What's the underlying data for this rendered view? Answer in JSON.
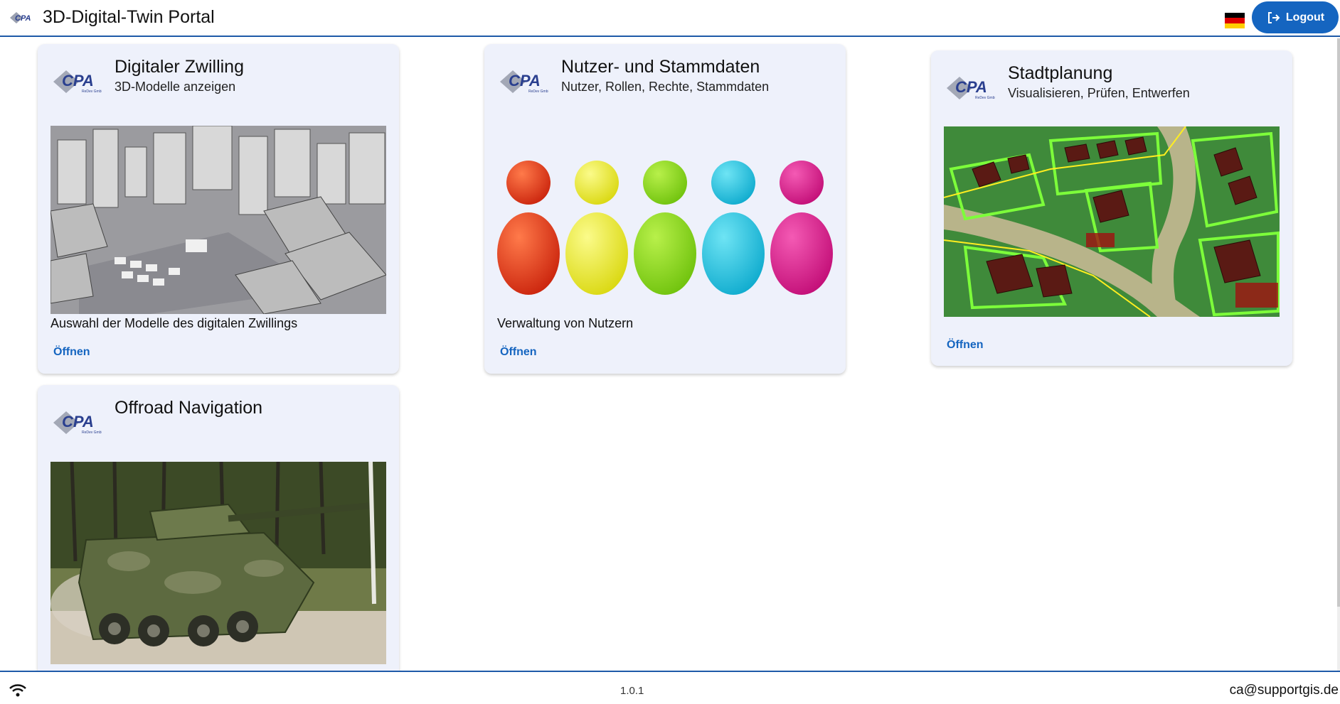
{
  "app": {
    "title": "3D-Digital-Twin Portal",
    "logo_text": "CPA",
    "language_flag": "de-flag-icon",
    "logout_label": "Logout"
  },
  "cards": [
    {
      "title": "Digitaler Zwilling",
      "subtitle": "3D-Modelle anzeigen",
      "description": "Auswahl der Modelle des digitalen Zwillings",
      "action": "Öffnen",
      "image": "3d-city-model-image"
    },
    {
      "title": "Nutzer- und Stammdaten",
      "subtitle": "Nutzer, Rollen, Rechte, Stammdaten",
      "description": "Verwaltung von Nutzern",
      "action": "Öffnen",
      "image": "colored-user-figures-image"
    },
    {
      "title": "Stadtplanung",
      "subtitle": "Visualisieren, Prüfen, Entwerfen",
      "description": "",
      "action": "Öffnen",
      "image": "urban-planning-plots-image"
    },
    {
      "title": "Offroad Navigation",
      "subtitle": "",
      "description": "",
      "action": "",
      "image": "armored-vehicle-image"
    }
  ],
  "footer": {
    "version": "1.0.1",
    "email": "ca@supportgis.de",
    "connection_icon": "wifi-icon"
  },
  "colors": {
    "accent": "#1565c0",
    "card_bg": "#eef1fb",
    "divider": "#1e5aa8"
  }
}
